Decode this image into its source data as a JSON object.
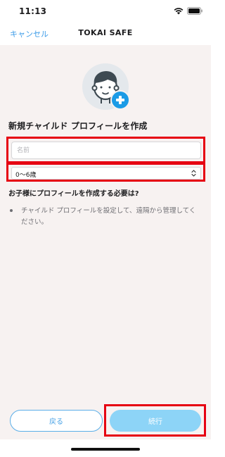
{
  "status_bar": {
    "time": "11:13",
    "icons": [
      "wifi-icon",
      "battery-icon"
    ]
  },
  "nav": {
    "cancel_label": "キャンセル",
    "title": "TOKAI SAFE"
  },
  "avatar": {
    "icon": "child-avatar-icon",
    "badge_icon": "add-plus-icon"
  },
  "form": {
    "section_title": "新規チャイルド プロフィールを作成",
    "name_placeholder": "名前",
    "name_value": "",
    "age_selected": "0〜6歳"
  },
  "info": {
    "question": "お子様にプロフィールを作成する必要は?",
    "bullets": [
      "チャイルド プロフィールを設定して、遠隔から管理してください。"
    ]
  },
  "footer": {
    "back_label": "戻る",
    "next_label": "続行"
  },
  "colors": {
    "accent": "#3d9ce8",
    "badge": "#1b9be6",
    "next_button": "#8dd4f7",
    "highlight": "#e60012",
    "background": "#f7f2f1"
  }
}
